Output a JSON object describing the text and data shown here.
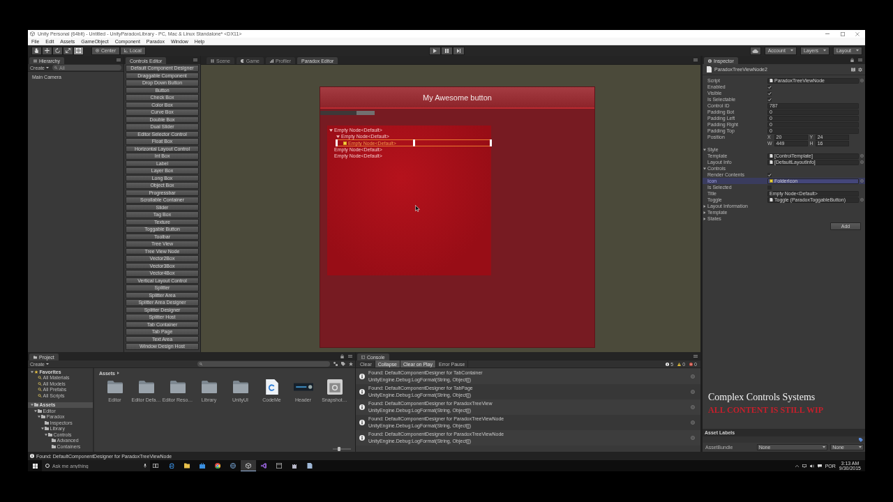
{
  "window": {
    "title": "Unity Personal (64bit) - Untitled - UnityParadoxLibrary - PC, Mac & Linux Standalone* <DX11>",
    "menu": [
      "File",
      "Edit",
      "Assets",
      "GameObject",
      "Component",
      "Paradox",
      "Window",
      "Help"
    ]
  },
  "toolbar": {
    "tools": [
      {
        "selected": false
      },
      {
        "selected": false
      },
      {
        "selected": false
      },
      {
        "selected": false
      },
      {
        "selected": true
      }
    ],
    "pivot": [
      "Center",
      "Local"
    ],
    "playback": [
      {
        "selected": false
      },
      {
        "selected": false
      },
      {
        "selected": false
      }
    ],
    "menus": [
      "Account",
      "Layers",
      "Layout"
    ]
  },
  "hierarchy": {
    "tab": "Hierarchy",
    "create": "Create",
    "search_placeholder": "All",
    "items": [
      "Main Camera"
    ]
  },
  "toolbox": {
    "tab": "Controls Editor",
    "buttons": [
      "Default Component Designer",
      "Draggable Component",
      "Drop Down Button",
      "Button",
      "Check Box",
      "Color Box",
      "Curve Box",
      "Double Box",
      "Dual Slider",
      "Editor Selector Control",
      "Float Box",
      "Horizontal Layout Control",
      "Int Box",
      "Label",
      "Layer Box",
      "Long Box",
      "Object Box",
      "Progressbar",
      "Scrollable Container",
      "Slider",
      "Tag Box",
      "Texture",
      "Toggable Button",
      "Toolbar",
      "Tree View",
      "Tree View Node",
      "Vector2Box",
      "Vector3Box",
      "Vector4Box",
      "Vertical Layout Control",
      "Splitter",
      "Splitter Area",
      "Splitter Area Designer",
      "Splitter Designer",
      "Splitter Host",
      "Tab Container",
      "Tab Page",
      "Text Area",
      "Window Design Host"
    ]
  },
  "scene": {
    "tabs": [
      {
        "label": "Scene",
        "selected": false
      },
      {
        "label": "Game",
        "selected": false
      },
      {
        "label": "Profiler",
        "selected": false
      },
      {
        "label": "Paradox Editor",
        "selected": true
      }
    ],
    "window_title": "My Awesome button",
    "tree": [
      {
        "label": "Empty Node<Default>",
        "expanded": true,
        "selected": false,
        "children": [
          {
            "label": "Empty Node<Default>",
            "expanded": true,
            "selected": false,
            "children": [
              {
                "label": "Empty Node<Default>",
                "selected": true
              }
            ]
          }
        ]
      },
      {
        "label": "Empty Node<Default>",
        "selected": false
      },
      {
        "label": "Empty Node<Default>",
        "selected": false
      }
    ]
  },
  "inspector": {
    "tab": "Inspector",
    "object_name": "ParadoxTreeViewNode2",
    "fields": [
      {
        "kind": "object",
        "label": "Script",
        "value": "ParadoxTreeViewNode",
        "selected": false
      },
      {
        "kind": "check",
        "label": "Enabled",
        "checked": true,
        "selected": false
      },
      {
        "kind": "check",
        "label": "Visible",
        "checked": true,
        "selected": false
      },
      {
        "kind": "check",
        "label": "Is Selectable",
        "checked": true,
        "selected": false
      },
      {
        "kind": "text",
        "label": "Control ID",
        "value": "787",
        "selected": false
      },
      {
        "kind": "text",
        "label": "Padding Bot",
        "value": "0",
        "selected": false
      },
      {
        "kind": "text",
        "label": "Padding Left",
        "value": "0",
        "selected": false
      },
      {
        "kind": "text",
        "label": "Padding Right",
        "value": "0",
        "selected": false
      },
      {
        "kind": "text",
        "label": "Padding Top",
        "value": "0",
        "selected": false
      },
      {
        "kind": "rect",
        "label": "Position",
        "parts": [
          {
            "axis": "X",
            "value": "20"
          },
          {
            "axis": "Y",
            "value": "24"
          },
          {
            "axis": "W",
            "value": "449"
          },
          {
            "axis": "H",
            "value": "16"
          }
        ],
        "selected": false
      },
      {
        "kind": "foldout",
        "label": "Style",
        "expanded": true,
        "selected": false
      },
      {
        "kind": "object",
        "label": "Template",
        "value": "[ControlTemplate]",
        "selected": false
      },
      {
        "kind": "object",
        "label": "Layout Info",
        "value": "[DefaultLayoutInfo]",
        "selected": false
      },
      {
        "kind": "foldout",
        "label": "Controls",
        "expanded": true,
        "selected": false
      },
      {
        "kind": "check",
        "label": "Render Contents",
        "checked": true,
        "selected": false
      },
      {
        "kind": "image",
        "label": "Icon",
        "value": "FolderIcon",
        "selected": true
      },
      {
        "kind": "check",
        "label": "Is Selected",
        "checked": false,
        "selected": false
      },
      {
        "kind": "text",
        "label": "Title",
        "value": "Empty Node<Default>",
        "selected": false
      },
      {
        "kind": "object",
        "label": "Toggle",
        "value": "Toggle (ParadoxToggableButton)",
        "selected": false
      },
      {
        "kind": "foldout",
        "label": "Layout Information",
        "expanded": false,
        "selected": false
      },
      {
        "kind": "foldout",
        "label": "Template",
        "expanded": false,
        "selected": false
      },
      {
        "kind": "foldout",
        "label": "States",
        "expanded": false,
        "selected": false
      }
    ],
    "add_button": "Add",
    "asset_labels": {
      "title": "Asset Labels",
      "bundle_label": "AssetBundle",
      "bundle_values": [
        "None",
        "None"
      ]
    }
  },
  "overlay": {
    "caption": "Complex Controls Systems",
    "notice": "ALL CONTENT IS STILL WIP"
  },
  "project": {
    "tab": "Project",
    "create": "Create",
    "tree": [
      {
        "label": "Favorites",
        "kind": "favorites",
        "expanded": true,
        "selected": false,
        "children": [
          {
            "label": "All Materials",
            "kind": "search",
            "selected": false
          },
          {
            "label": "All Models",
            "kind": "search",
            "selected": false
          },
          {
            "label": "All Prefabs",
            "kind": "search",
            "selected": false
          },
          {
            "label": "All Scripts",
            "kind": "search",
            "selected": false
          }
        ]
      },
      {
        "label": "Assets",
        "kind": "folder",
        "expanded": true,
        "selected": true,
        "children": [
          {
            "label": "Editor",
            "kind": "folder",
            "expanded": true,
            "selected": false,
            "children": [
              {
                "label": "Paradox",
                "kind": "folder",
                "expanded": true,
                "selected": false,
                "children": [
                  {
                    "label": "Inspectors",
                    "kind": "folder",
                    "selected": false
                  },
                  {
                    "label": "Library",
                    "kind": "folder",
                    "expanded": true,
                    "selected": false,
                    "children": [
                      {
                        "label": "Controls",
                        "kind": "folder",
                        "expanded": true,
                        "selected": false,
                        "children": [
                          {
                            "label": "Advanced",
                            "kind": "folder",
                            "selected": false
                          },
                          {
                            "label": "Containers",
                            "kind": "folder",
                            "selected": false
                          }
                        ]
                      }
                    ]
                  }
                ]
              }
            ]
          }
        ]
      }
    ],
    "breadcrumb": "Assets",
    "assets": [
      {
        "kind": "folder",
        "name": "Editor"
      },
      {
        "kind": "folder",
        "name": "Editor Defa…"
      },
      {
        "kind": "folder",
        "name": "Editor Reso…"
      },
      {
        "kind": "folder",
        "name": "Library"
      },
      {
        "kind": "folder",
        "name": "UnityUI"
      },
      {
        "kind": "script",
        "name": "CodeMe"
      },
      {
        "kind": "image",
        "name": "Header"
      },
      {
        "kind": "asset",
        "name": "Snapshot…"
      }
    ],
    "icon_size": {
      "level": 0.35
    }
  },
  "console": {
    "tab": "Console",
    "toggles": [
      {
        "label": "Clear",
        "selected": false
      },
      {
        "label": "Collapse",
        "selected": true
      },
      {
        "label": "Clear on Play",
        "selected": true
      },
      {
        "label": "Error Pause",
        "selected": false
      }
    ],
    "counts": [
      {
        "kind": "info",
        "value": "5"
      },
      {
        "kind": "warning",
        "value": "0"
      },
      {
        "kind": "error",
        "value": "0"
      }
    ],
    "messages": [
      {
        "text": "Found: DefaultComponentDesigner for TabContainer",
        "trace": "UnityEngine.Debug:LogFormat(String, Object[])"
      },
      {
        "text": "Found: DefaultComponentDesigner for TabPage",
        "trace": "UnityEngine.Debug:LogFormat(String, Object[])"
      },
      {
        "text": "Found: DefaultComponentDesigner for ParadoxTreeView",
        "trace": "UnityEngine.Debug:LogFormat(String, Object[])"
      },
      {
        "text": "Found: DefaultComponentDesigner for ParadoxTreeViewNode",
        "trace": "UnityEngine.Debug:LogFormat(String, Object[])"
      },
      {
        "text": "Found: DefaultComponentDesigner for ParadoxTreeViewNode",
        "trace": "UnityEngine.Debug:LogFormat(String, Object[])"
      }
    ]
  },
  "status_bar": "Found: DefaultComponentDesigner for ParadoxTreeViewNode",
  "taskbar": {
    "search_placeholder": "Ask me anything",
    "apps": [
      {
        "selected": false
      },
      {
        "selected": false
      },
      {
        "selected": false
      },
      {
        "selected": false
      },
      {
        "selected": false
      },
      {
        "selected": true
      },
      {
        "selected": false
      },
      {
        "selected": false
      },
      {
        "selected": false
      },
      {
        "selected": false
      }
    ],
    "language": "POR",
    "time": "3:13 AM",
    "date": "9/30/2015"
  }
}
